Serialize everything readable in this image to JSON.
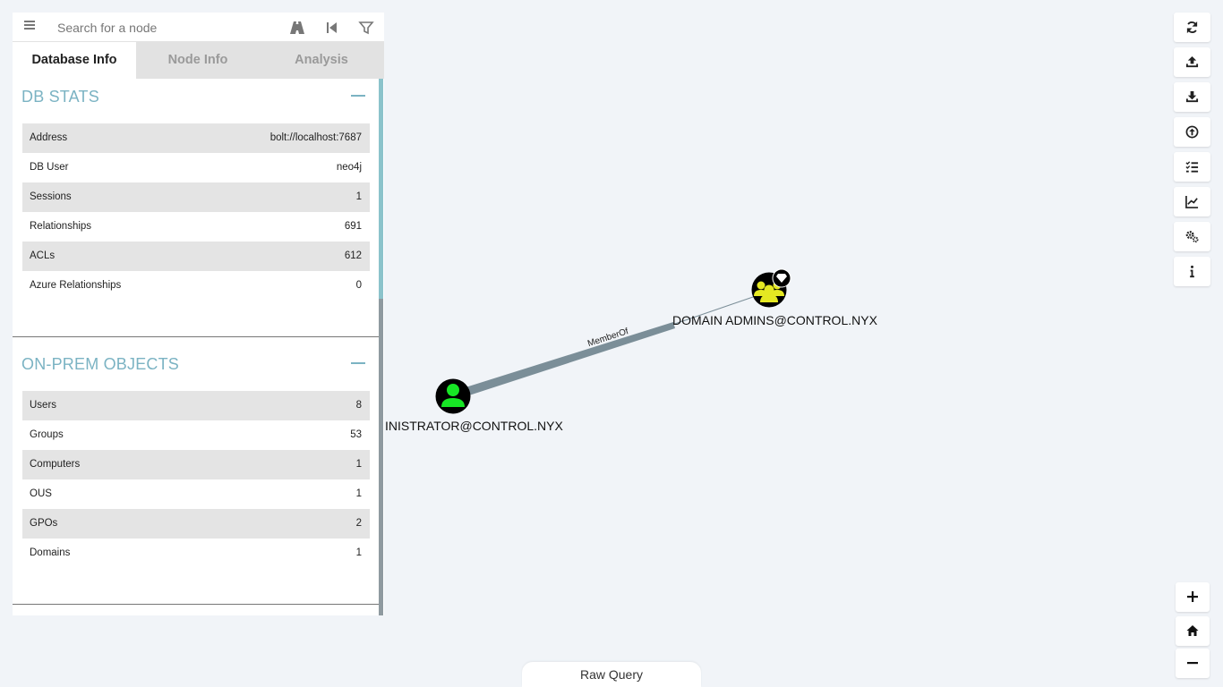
{
  "search": {
    "placeholder": "Search for a node"
  },
  "icons": {
    "menu": "hamburger-menu-icon",
    "pathfinding": "road-icon",
    "back": "step-backward-icon",
    "filter": "filter-icon"
  },
  "tabs": [
    {
      "label": "Database Info",
      "active": true
    },
    {
      "label": "Node Info",
      "active": false
    },
    {
      "label": "Analysis",
      "active": false
    }
  ],
  "db_stats": {
    "title": "DB STATS",
    "rows": [
      {
        "label": "Address",
        "value": "bolt://localhost:7687"
      },
      {
        "label": "DB User",
        "value": "neo4j"
      },
      {
        "label": "Sessions",
        "value": "1"
      },
      {
        "label": "Relationships",
        "value": "691"
      },
      {
        "label": "ACLs",
        "value": "612"
      },
      {
        "label": "Azure Relationships",
        "value": "0"
      }
    ]
  },
  "onprem_objects": {
    "title": "ON-PREM OBJECTS",
    "rows": [
      {
        "label": "Users",
        "value": "8"
      },
      {
        "label": "Groups",
        "value": "53"
      },
      {
        "label": "Computers",
        "value": "1"
      },
      {
        "label": "OUS",
        "value": "1"
      },
      {
        "label": "GPOs",
        "value": "2"
      },
      {
        "label": "Domains",
        "value": "1"
      }
    ]
  },
  "graph": {
    "nodes": [
      {
        "label": "DOMAIN ADMINS@CONTROL.NYX",
        "type": "group",
        "high_value": true,
        "color": "#e5e822"
      },
      {
        "label": "INISTRATOR@CONTROL.NYX",
        "type": "user",
        "color": "#17e625"
      }
    ],
    "edges": [
      {
        "label": "MemberOf",
        "from": "INISTRATOR@CONTROL.NYX",
        "to": "DOMAIN ADMINS@CONTROL.NYX"
      }
    ]
  },
  "toolbar": [
    "refresh-icon",
    "upload-icon",
    "download-icon",
    "import-icon",
    "query-list-icon",
    "stats-chart-icon",
    "settings-icon",
    "info-icon"
  ],
  "zoom": [
    "zoom-in-icon",
    "home-icon",
    "zoom-out-icon"
  ],
  "raw_query": {
    "label": "Raw Query"
  },
  "colors": {
    "accent": "#7bb3c3",
    "edge": "#7b8e98",
    "background": "#f1f4f8"
  }
}
